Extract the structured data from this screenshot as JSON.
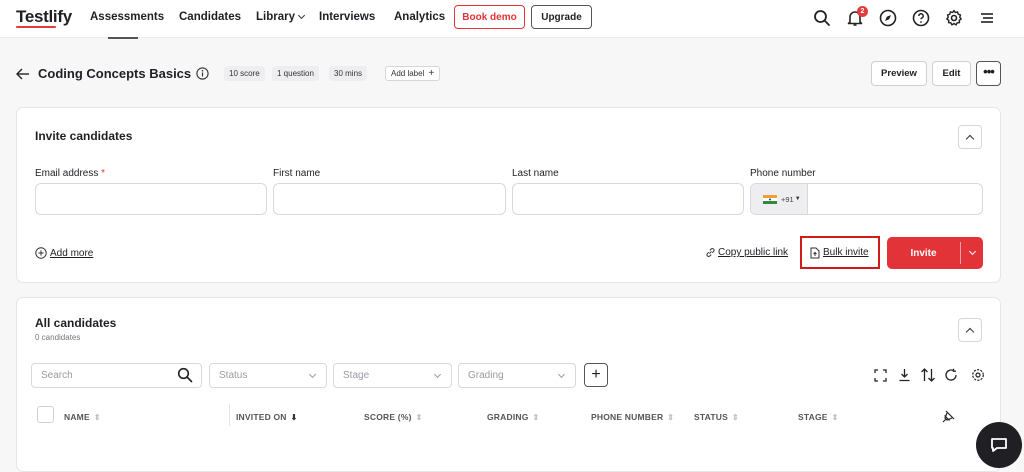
{
  "app": {
    "logo": "Testlify"
  },
  "nav": {
    "items": [
      {
        "label": "Assessments"
      },
      {
        "label": "Candidates"
      },
      {
        "label": "Library"
      },
      {
        "label": "Interviews"
      },
      {
        "label": "Analytics"
      }
    ],
    "book_demo": "Book demo",
    "upgrade": "Upgrade",
    "notification_count": "2"
  },
  "header": {
    "title": "Coding Concepts Basics",
    "chips": [
      "10 score",
      "1 question",
      "30 mins"
    ],
    "add_label": "Add label",
    "preview": "Preview",
    "edit": "Edit"
  },
  "invite_card": {
    "title": "Invite candidates",
    "email_label": "Email address",
    "required_mark": "*",
    "first_name_label": "First name",
    "last_name_label": "Last name",
    "phone_label": "Phone number",
    "phone_code": "+91",
    "add_more": "Add more",
    "copy_public_link": "Copy public link",
    "bulk_invite": "Bulk invite",
    "invite_button": "Invite"
  },
  "candidates_card": {
    "title": "All candidates",
    "count": "0 candidates",
    "search_placeholder": "Search",
    "filters": [
      "Status",
      "Stage",
      "Grading"
    ],
    "columns": [
      "NAME",
      "INVITED ON",
      "SCORE (%)",
      "GRADING",
      "PHONE NUMBER",
      "STATUS",
      "STAGE"
    ]
  },
  "colors": {
    "accent": "#e23339",
    "highlight": "#d11a1a"
  }
}
